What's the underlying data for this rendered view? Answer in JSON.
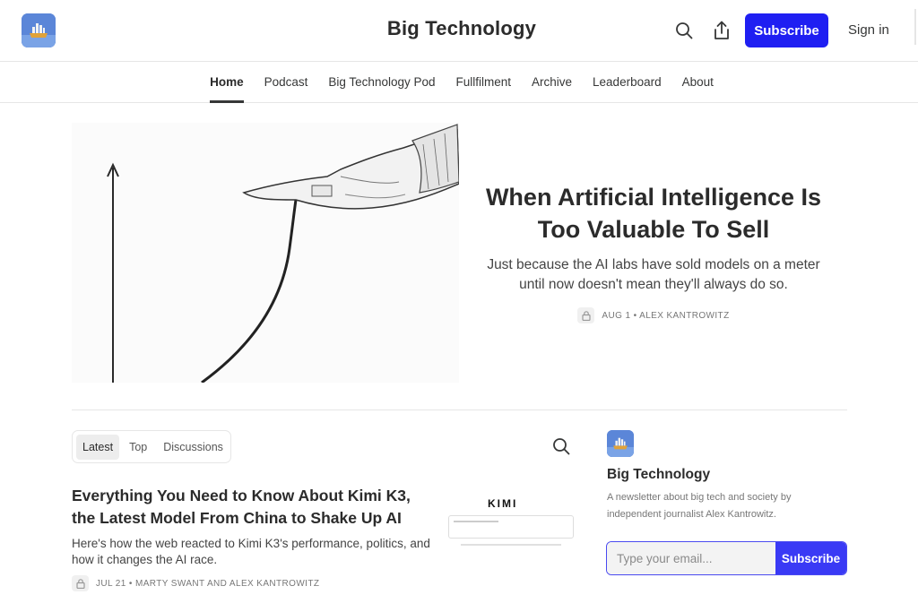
{
  "header": {
    "title": "Big Technology",
    "subscribe_label": "Subscribe",
    "signin_label": "Sign in"
  },
  "nav": {
    "items": [
      {
        "label": "Home",
        "active": true
      },
      {
        "label": "Podcast"
      },
      {
        "label": "Big Technology Pod"
      },
      {
        "label": "Fullfilment"
      },
      {
        "label": "Archive"
      },
      {
        "label": "Leaderboard"
      },
      {
        "label": "About"
      }
    ]
  },
  "hero": {
    "title": "When Artificial Intelligence Is Too Valuable To Sell",
    "subtitle": "Just because the AI labs have sold models on a meter until now doesn't mean they'll always do so.",
    "meta": "AUG 1 • ALEX KANTROWITZ"
  },
  "tabs": {
    "items": [
      "Latest",
      "Top",
      "Discussions"
    ],
    "active": "Latest"
  },
  "post": {
    "title": "Everything You Need to Know About Kimi K3, the Latest Model From China to Shake Up AI",
    "subtitle": "Here's how the web reacted to Kimi K3's performance, politics, and how it changes the AI race.",
    "meta": "JUL 21 • MARTY SWANT AND ALEX KANTROWITZ",
    "thumb_text": "KIMI"
  },
  "sidebar": {
    "title": "Big Technology",
    "description": "A newsletter about big tech and society by independent journalist Alex Kantrowitz.",
    "email_placeholder": "Type your email...",
    "subscribe_label": "Subscribe"
  },
  "colors": {
    "accent": "#1f1ff2",
    "logo_bg": "#4f7fd6"
  },
  "icons": [
    "search-icon",
    "share-icon",
    "lock-icon"
  ]
}
